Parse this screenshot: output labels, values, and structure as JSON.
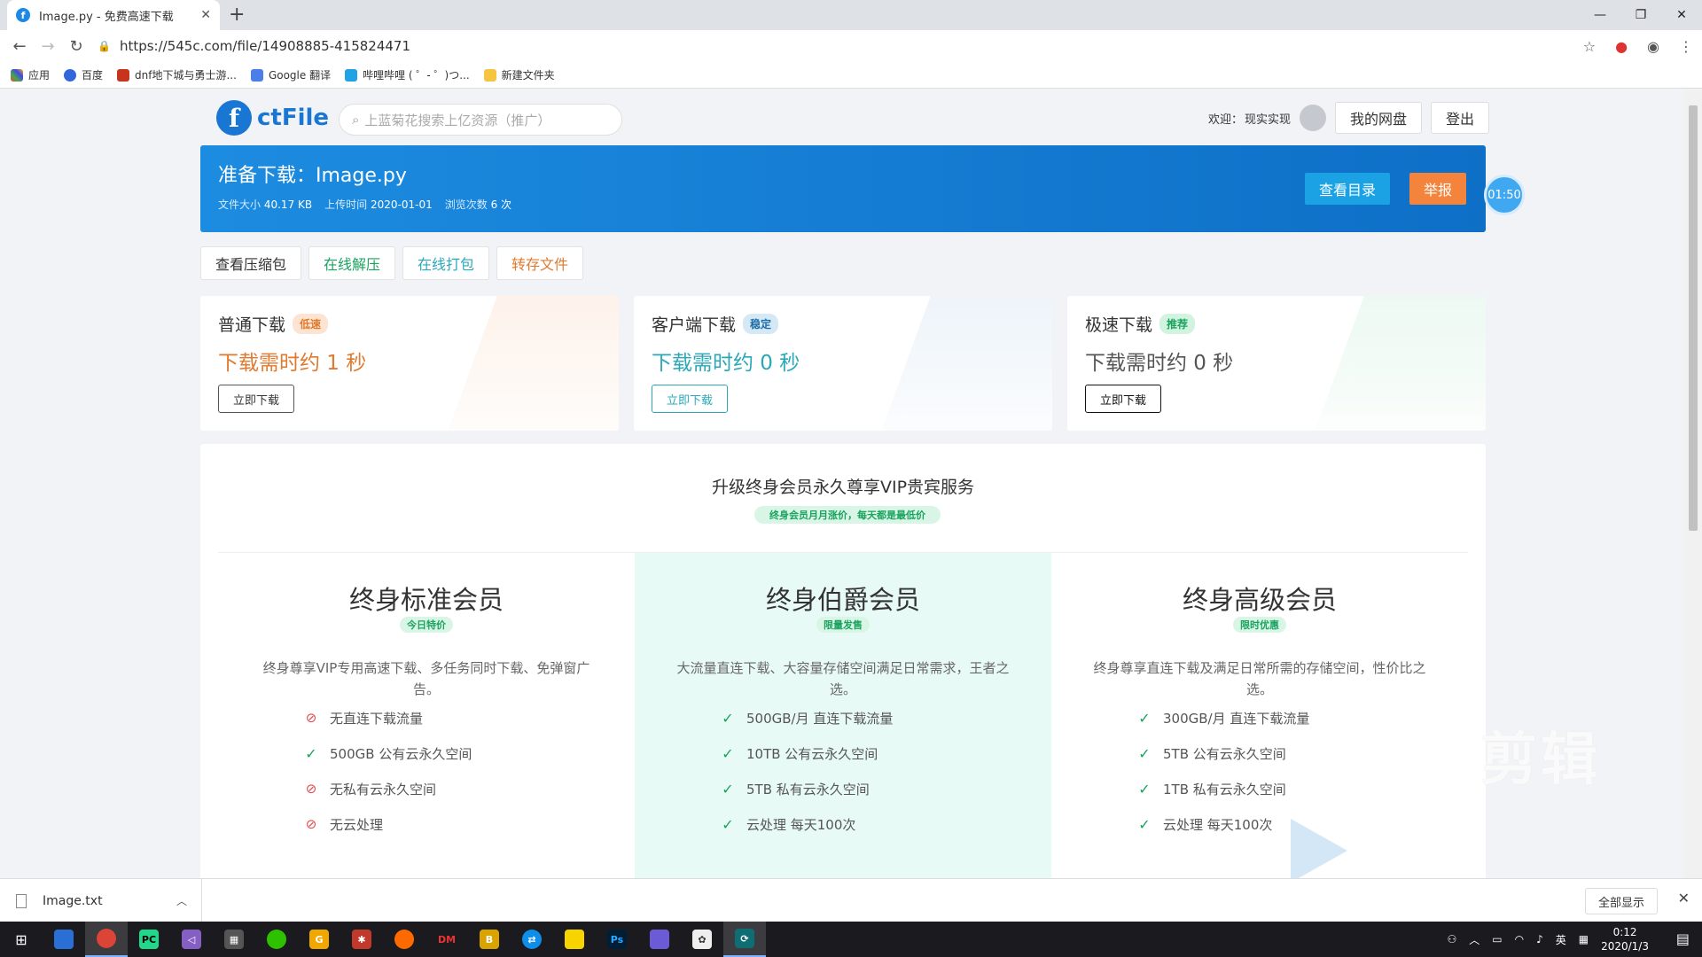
{
  "browser": {
    "tab_title": "Image.py - 免费高速下载",
    "url": "https://545c.com/file/14908885-415824471",
    "bookmarks": [
      "应用",
      "百度",
      "dnf地下城与勇士游...",
      "Google 翻译",
      "哔哩哔哩 ( ゜- ゜)つ...",
      "新建文件夹"
    ]
  },
  "header": {
    "logo_text": "ctFile",
    "search_placeholder": "上蓝菊花搜索上亿资源（推广）",
    "welcome": "欢迎：",
    "username": "现实实现",
    "my_disk": "我的网盘",
    "logout": "登出"
  },
  "banner": {
    "title": "准备下载：Image.py",
    "size_label": "文件大小",
    "size": "40.17 KB",
    "upload_label": "上传时间",
    "upload_date": "2020-01-01",
    "views_label": "浏览次数",
    "views": "6 次",
    "dir_button": "查看目录",
    "report_button": "举报",
    "timer": "01:50"
  },
  "tools": [
    "查看压缩包",
    "在线解压",
    "在线打包",
    "转存文件"
  ],
  "download_cards": [
    {
      "title": "普通下载",
      "badge": "低速",
      "time": "下载需时约 1 秒",
      "button": "立即下载"
    },
    {
      "title": "客户端下载",
      "badge": "稳定",
      "time": "下载需时约 0 秒",
      "button": "立即下载"
    },
    {
      "title": "极速下载",
      "badge": "推荐",
      "time": "下载需时约 0 秒",
      "button": "立即下载"
    }
  ],
  "vip": {
    "heading": "升级终身会员永久尊享VIP贵宾服务",
    "subtag": "终身会员月月涨价，每天都是最低价",
    "plans": [
      {
        "name": "终身标准会员",
        "tag": "今日特价",
        "desc": "终身尊享VIP专用高速下载、多任务同时下载、免弹窗广告。",
        "features": [
          {
            "text": "无直连下载流量",
            "ok": false
          },
          {
            "text": "500GB 公有云永久空间",
            "ok": true
          },
          {
            "text": "无私有云永久空间",
            "ok": false
          },
          {
            "text": "无云处理",
            "ok": false
          }
        ]
      },
      {
        "name": "终身伯爵会员",
        "tag": "限量发售",
        "desc": "大流量直连下载、大容量存储空间满足日常需求，王者之选。",
        "features": [
          {
            "text": "500GB/月 直连下载流量",
            "ok": true
          },
          {
            "text": "10TB 公有云永久空间",
            "ok": true
          },
          {
            "text": "5TB 私有云永久空间",
            "ok": true
          },
          {
            "text": "云处理 每天100次",
            "ok": true
          }
        ]
      },
      {
        "name": "终身高级会员",
        "tag": "限时优惠",
        "desc": "终身尊享直连下载及满足日常所需的存储空间，性价比之选。",
        "features": [
          {
            "text": "300GB/月 直连下载流量",
            "ok": true
          },
          {
            "text": "5TB 公有云永久空间",
            "ok": true
          },
          {
            "text": "1TB 私有云永久空间",
            "ok": true
          },
          {
            "text": "云处理 每天100次",
            "ok": true
          }
        ]
      }
    ]
  },
  "watermark": "剪辑",
  "shelf": {
    "file": "Image.txt",
    "show_all": "全部显示"
  },
  "taskbar": {
    "ime": "英",
    "time": "0:12",
    "date": "2020/1/3"
  },
  "colors": {
    "brand": "#1976d2",
    "orange": "#f4833c",
    "green": "#1aa35e",
    "teal": "#2aa8b8"
  }
}
